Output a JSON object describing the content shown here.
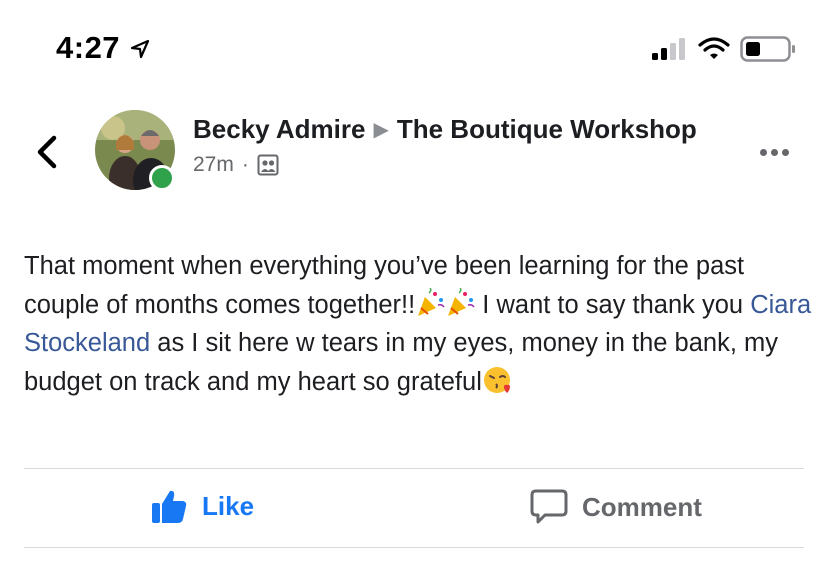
{
  "status_bar": {
    "time": "4:27"
  },
  "post": {
    "author": "Becky Admire",
    "group": "The Boutique Workshop",
    "timestamp": "27m",
    "body": {
      "part1": "That moment when everything you’ve been learning for the past couple of months comes together!!",
      "part2": " I want to say thank you ",
      "mention": "Ciara Stockeland",
      "part3": " as I sit here w tears in my eyes, money in the bank, my budget on track and my heart so grateful"
    }
  },
  "actions": {
    "like_label": "Like",
    "comment_label": "Comment"
  },
  "icons": {
    "back": "chevron-left-icon",
    "more": "more-horizontal-icon",
    "audience": "group-audience-icon",
    "like": "thumbs-up-icon",
    "comment": "speech-bubble-icon",
    "emoji_party": "party-popper-emoji",
    "emoji_kiss": "face-blowing-kiss-emoji"
  },
  "colors": {
    "like_blue": "#1877f2",
    "mention_blue": "#385898",
    "online_green": "#31a24c",
    "meta_gray": "#65676b"
  }
}
